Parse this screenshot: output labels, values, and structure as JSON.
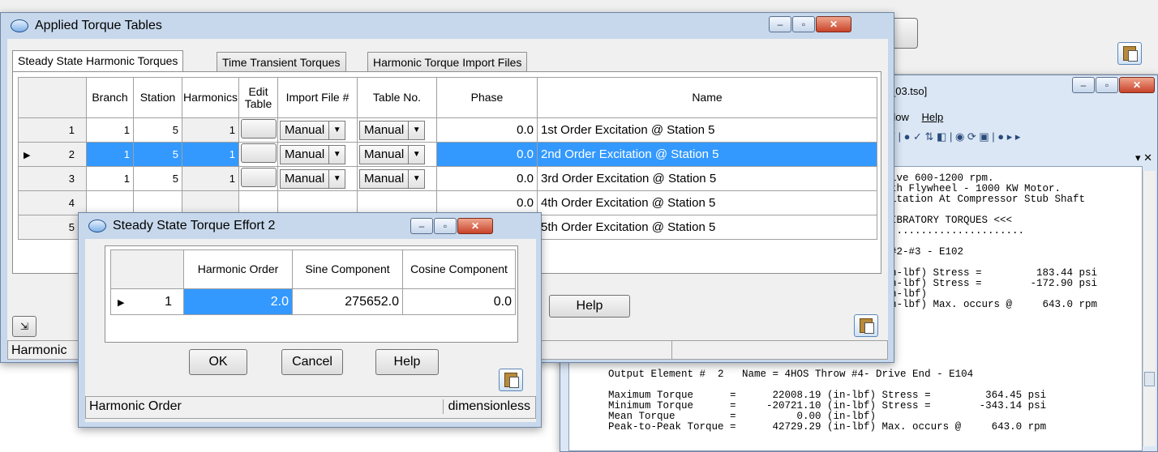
{
  "bg_window": {
    "title_fragment": "_03.tso]",
    "menu_window": "dow",
    "menu_help": "Help",
    "output_lines": [
      "ive 600-1200 rpm.",
      "th Flywheel - 1000 KW Motor.",
      "itation At Compressor Stub Shaft",
      "",
      "IBRATORY TORQUES <<<",
      "......................",
      "",
      "#2-#3 - E102",
      "",
      "n-lbf) Stress =         183.44 psi",
      "n-lbf) Stress =        -172.90 psi",
      "n-lbf)",
      "n-lbf) Max. occurs @     643.0 rpm"
    ],
    "output_lines_wide": [
      "Output Element #  2   Name = 4HOS Throw #4- Drive End - E104",
      "",
      "Maximum Torque      =      22008.19 (in-lbf) Stress =         364.45 psi",
      "Minimum Torque      =     -20721.10 (in-lbf) Stress =        -343.14 psi",
      "Mean Torque         =          0.00 (in-lbf)",
      "Peak-to-Peak Torque =      42729.29 (in-lbf) Max. occurs @     643.0 rpm"
    ]
  },
  "torque_tables": {
    "title": "Applied Torque Tables",
    "tabs": [
      "Steady State Harmonic Torques",
      "Time Transient Torques",
      "Harmonic Torque Import Files"
    ],
    "columns": [
      "Branch",
      "Station",
      "Harmonics",
      "Edit Table",
      "Import File #",
      "Table No.",
      "Phase",
      "Name"
    ],
    "rows": [
      {
        "n": "1",
        "branch": "1",
        "station": "5",
        "harmonics": "1",
        "import": "Manual",
        "table": "Manual",
        "phase": "0.0",
        "name": "1st Order Excitation @ Station 5"
      },
      {
        "n": "2",
        "branch": "1",
        "station": "5",
        "harmonics": "1",
        "import": "Manual",
        "table": "Manual",
        "phase": "0.0",
        "name": "2nd Order Excitation @ Station 5"
      },
      {
        "n": "3",
        "branch": "1",
        "station": "5",
        "harmonics": "1",
        "import": "Manual",
        "table": "Manual",
        "phase": "0.0",
        "name": "3rd Order Excitation @ Station 5"
      },
      {
        "n": "4",
        "branch": "",
        "station": "",
        "harmonics": "",
        "import": "",
        "table": "",
        "phase": "0.0",
        "name": "4th Order Excitation @ Station 5"
      },
      {
        "n": "5",
        "branch": "",
        "station": "",
        "harmonics": "",
        "import": "",
        "table": "",
        "phase": "0.0",
        "name": "5th Order Excitation @ Station 5"
      }
    ],
    "help_label": "Help",
    "status_text": "Harmonic"
  },
  "effort_dialog": {
    "title": "Steady State Torque Effort 2",
    "columns": [
      "Harmonic Order",
      "Sine Component",
      "Cosine Component"
    ],
    "row": {
      "n": "1",
      "order": "2.0",
      "sine": "275652.0",
      "cosine": "0.0"
    },
    "ok_label": "OK",
    "cancel_label": "Cancel",
    "help_label": "Help",
    "status_left": "Harmonic Order",
    "status_right": "dimensionless"
  }
}
